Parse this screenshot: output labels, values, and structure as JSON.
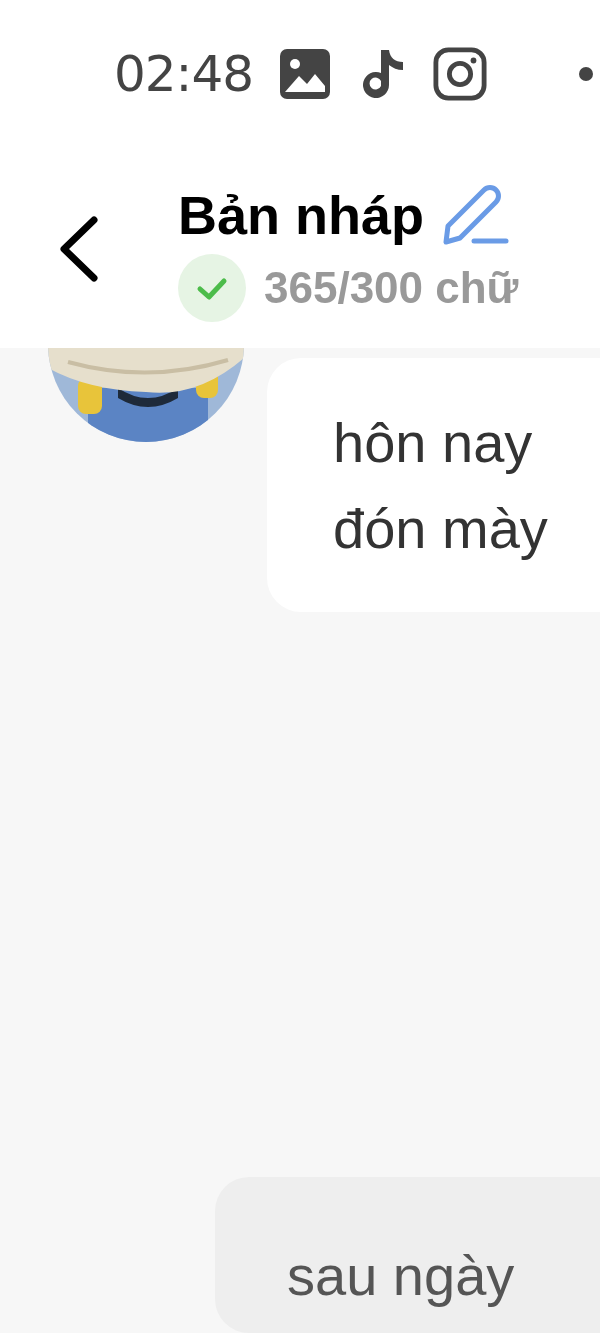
{
  "status_bar": {
    "time": "02:48"
  },
  "header": {
    "title": "Bản nháp",
    "word_count": "365/300 chữ"
  },
  "messages": [
    {
      "kind": "received",
      "lines": [
        "hôn nay",
        "đón mày"
      ]
    },
    {
      "kind": "sent",
      "lines": [
        "sau ngày"
      ]
    }
  ]
}
